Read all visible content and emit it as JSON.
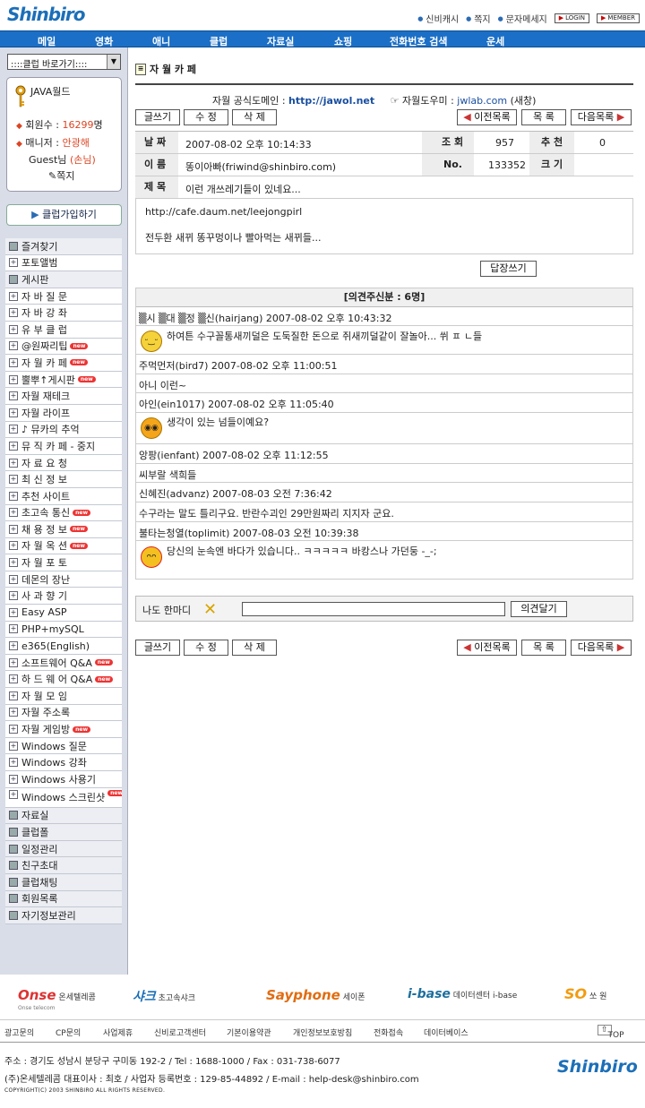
{
  "header": {
    "logo": "Shinbiro",
    "links": [
      "신비캐시",
      "쪽지",
      "문자메세지"
    ],
    "login": "LOGIN",
    "member": "MEMBER"
  },
  "gnav": [
    "메일",
    "영화",
    "애니",
    "클럽",
    "자료실",
    "쇼핑",
    "전화번호 검색",
    "운세"
  ],
  "sidebar": {
    "quick_select": "::::클럽 바로가기::::",
    "club_name": "JAVA월드",
    "members_label": "회원수 : ",
    "members_value": "16299",
    "members_unit": "명",
    "manager_label": "매니저 : ",
    "manager_value": "안광해",
    "guest": "Guest님",
    "guest_role": "(손님)",
    "note": "쪽지",
    "join": "클럽가입하기",
    "menu": [
      {
        "label": "즐겨찾기",
        "h": true
      },
      {
        "label": "포토앨범"
      },
      {
        "label": "게시판",
        "h": true
      },
      {
        "label": "자 바 질 문"
      },
      {
        "label": "자 바 강 좌"
      },
      {
        "label": "유 부 클 럽"
      },
      {
        "label": "@원짜리팁",
        "new": true
      },
      {
        "label": "자 월 카 페",
        "new": true
      },
      {
        "label": "뿔뿌↑게시판",
        "new": true
      },
      {
        "label": "자월 재테크"
      },
      {
        "label": "자월 라이프"
      },
      {
        "label": "♪ 뮤카의 추억"
      },
      {
        "label": "뮤 직 카 페 - 중지"
      },
      {
        "label": "자 료 요 청"
      },
      {
        "label": "최 신 정 보"
      },
      {
        "label": "추천 사이트"
      },
      {
        "label": "초고속 통신",
        "new": true
      },
      {
        "label": "채 용 정 보",
        "new": true
      },
      {
        "label": "자 월 옥 션",
        "new": true
      },
      {
        "label": "자 월 포 토"
      },
      {
        "label": "데몬의 장난"
      },
      {
        "label": "사 과 향 기"
      },
      {
        "label": "Easy ASP"
      },
      {
        "label": "PHP+mySQL"
      },
      {
        "label": "e365(English)"
      },
      {
        "label": "소프트웨어 Q&A",
        "new": true
      },
      {
        "label": "하 드 웨 어 Q&A",
        "new": true
      },
      {
        "label": "자 월 모 임"
      },
      {
        "label": "자월 주소록"
      },
      {
        "label": "자월 게임방",
        "new": true
      },
      {
        "label": "Windows 질문"
      },
      {
        "label": "Windows 강좌"
      },
      {
        "label": "Windows 사용기"
      },
      {
        "label": "Windows 스크린샷",
        "new": true,
        "tall": true
      },
      {
        "label": "자료실",
        "h": true
      },
      {
        "label": "클럽폴",
        "h": true
      },
      {
        "label": "일정관리",
        "h": true
      },
      {
        "label": "친구초대",
        "h": true
      },
      {
        "label": "클럽채팅",
        "h": true
      },
      {
        "label": "회원목록",
        "h": true
      },
      {
        "label": "자기정보관리",
        "h": true
      }
    ]
  },
  "main": {
    "title": "자 월 카 페",
    "domain_label": "자월 공식도메인 : ",
    "domain_url": "http://jawol.net",
    "helper_label": "자월도우미 : ",
    "helper_url": "jwlab.com",
    "helper_suffix": "(새창)",
    "btn": {
      "write": "글쓰기",
      "edit": "수 정",
      "delete": "삭 제",
      "prev": "이전목록",
      "list": "목 록",
      "next": "다음목록",
      "answer": "답장쓰기",
      "comment": "의견달기"
    },
    "post": {
      "date_label": "날 짜",
      "date": "2007-08-02 오후 10:14:33",
      "views_label": "조 회",
      "views": "957",
      "rec_label": "추 천",
      "rec": "0",
      "name_label": "이 름",
      "name": "똥이아빠(friwind@shinbiro.com)",
      "no_label": "No.",
      "no": "133352",
      "size_label": "크 기",
      "size": "",
      "subject_label": "제 목",
      "subject": "이런 개쓰레기들이 있네요...",
      "body1": "http://cafe.daum.net/leejongpirl",
      "body2": "전두환 새뀌 똥꾸멍이나 빨아먹는 새뀌들..."
    },
    "comments_header": "[의견주신분 : 6명]",
    "comments": [
      "▒시 ▒대 ▒정 ▒신(hairjang) 2007-08-02 오후 10:43:32",
      "하여튼 수구꼴통새끼덜은 도둑질한 돈으로 쥐새끼덜같이 잘놀아... 쒸 ㅍ ㄴ들",
      "주먹먼저(bird7) 2007-08-02 오후 11:00:51",
      "아니 이런~",
      "아인(ein1017) 2007-08-02 오후 11:05:40",
      "생각이 있는 넘들이예요?",
      "앙팡(ienfant) 2007-08-02 오후 11:12:55",
      "씨부랄 색희들",
      "신혜진(advanz) 2007-08-03 오전 7:36:42",
      "수구라는 말도 틀리구요. 반란수괴인 29만원짜리 지지자 군요.",
      "불타는청열(toplimit) 2007-08-03 오전 10:39:38",
      "당신의 눈속엔 바다가 있습니다.. ㅋㅋㅋㅋㅋ 바캉스나 가던둥 -_-;"
    ],
    "reply_label": "나도 한마디"
  },
  "footer": {
    "partners": [
      [
        "Onse",
        "온세텔레콤"
      ],
      [
        "샤크",
        "초고속샤크"
      ],
      [
        "Sayphone",
        "세이폰"
      ],
      [
        "i-base",
        "데이터센터 i-base"
      ],
      [
        "SO",
        "쏘 원"
      ]
    ],
    "onse_sub": "Onse telecom",
    "links": [
      "광고문의",
      "CP문의",
      "사업제휴",
      "신비로고객센터",
      "기본이용약관",
      "개인정보보호방침",
      "전화접속",
      "데이터베이스"
    ],
    "top": "TOP",
    "addr1": "주소 : 경기도 성남시 분당구 구미동 192-2 / Tel : 1688-1000 / Fax : 031-738-6077",
    "addr2": "(주)온세텔레콤 대표이사 : 최호 / 사업자 등록번호 : 129-85-44892 / E-mail : help-desk@shinbiro.com",
    "copyright": "COPYRIGHT(C) 2003 SHINBIRO ALL RIGHTS RESERVED.",
    "logo": "Shinbiro"
  }
}
